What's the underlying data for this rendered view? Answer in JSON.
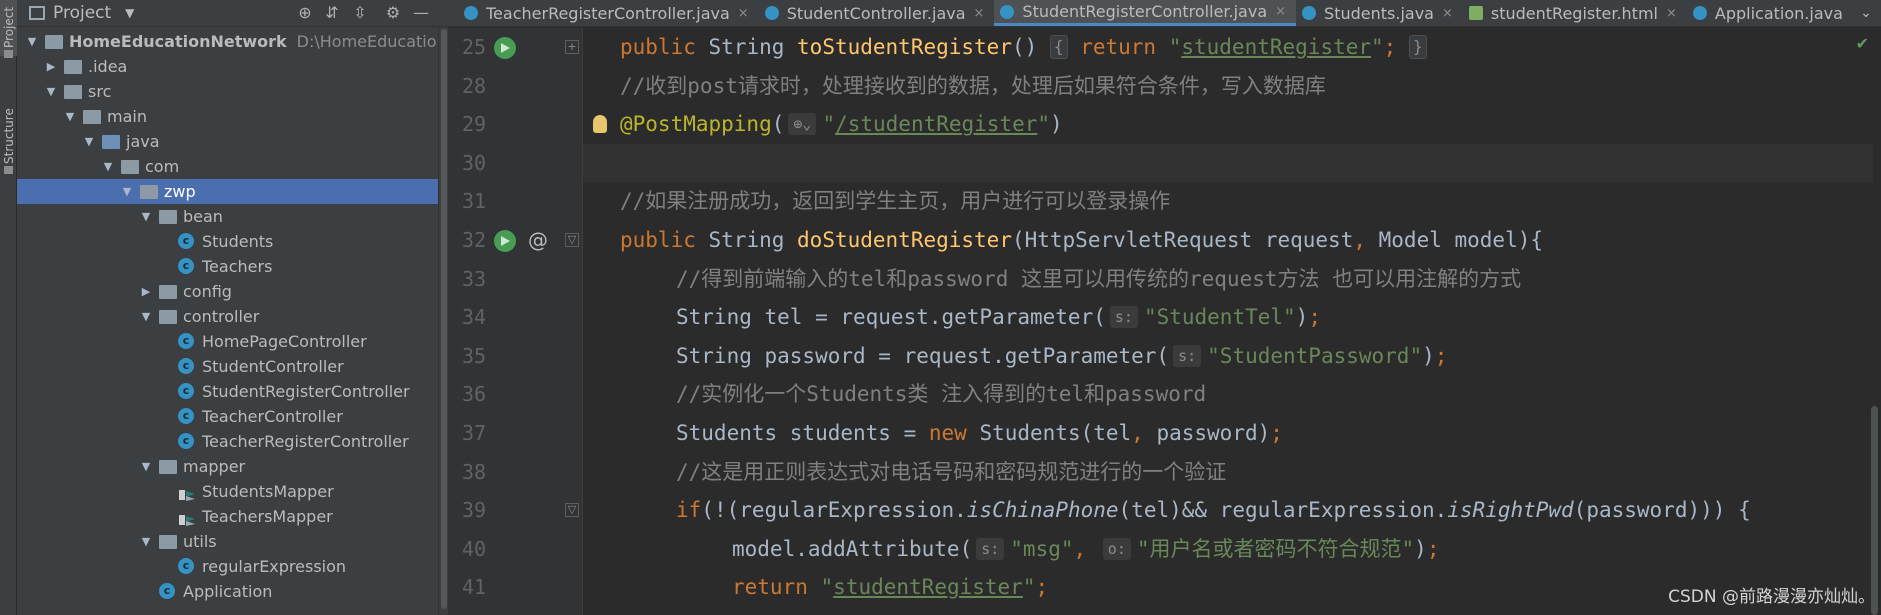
{
  "toolstrip": {
    "project_label": "Project",
    "structure_label": "Structure"
  },
  "project_panel": {
    "title": "Project",
    "icons": [
      "globe-icon",
      "collapse-all-icon",
      "expand-all-icon",
      "gear-icon",
      "minimize-icon"
    ],
    "tree": [
      {
        "name": "HomeEducationNetwork",
        "path": "D:\\HomeEducationNetwork",
        "kind": "module",
        "depth": 0,
        "expanded": true
      },
      {
        "name": ".idea",
        "kind": "folder",
        "depth": 1,
        "expanded": false
      },
      {
        "name": "src",
        "kind": "folder",
        "depth": 1,
        "expanded": true
      },
      {
        "name": "main",
        "kind": "folder",
        "depth": 2,
        "expanded": true
      },
      {
        "name": "java",
        "kind": "source-folder",
        "depth": 3,
        "expanded": true
      },
      {
        "name": "com",
        "kind": "package",
        "depth": 4,
        "expanded": true
      },
      {
        "name": "zwp",
        "kind": "package",
        "depth": 5,
        "expanded": true,
        "selected": true
      },
      {
        "name": "bean",
        "kind": "package",
        "depth": 6,
        "expanded": true
      },
      {
        "name": "Students",
        "kind": "class",
        "depth": 7
      },
      {
        "name": "Teachers",
        "kind": "class",
        "depth": 7
      },
      {
        "name": "config",
        "kind": "package",
        "depth": 6,
        "expanded": false
      },
      {
        "name": "controller",
        "kind": "package",
        "depth": 6,
        "expanded": true
      },
      {
        "name": "HomePageController",
        "kind": "class",
        "depth": 7
      },
      {
        "name": "StudentController",
        "kind": "class",
        "depth": 7
      },
      {
        "name": "StudentRegisterController",
        "kind": "class",
        "depth": 7
      },
      {
        "name": "TeacherController",
        "kind": "class",
        "depth": 7
      },
      {
        "name": "TeacherRegisterController",
        "kind": "class",
        "depth": 7
      },
      {
        "name": "mapper",
        "kind": "package",
        "depth": 6,
        "expanded": true
      },
      {
        "name": "StudentsMapper",
        "kind": "mapper",
        "depth": 7
      },
      {
        "name": "TeachersMapper",
        "kind": "mapper",
        "depth": 7
      },
      {
        "name": "utils",
        "kind": "package",
        "depth": 6,
        "expanded": true
      },
      {
        "name": "regularExpression",
        "kind": "class",
        "depth": 7
      },
      {
        "name": "Application",
        "kind": "app-class",
        "depth": 6
      }
    ]
  },
  "tabs": [
    {
      "label": "TeacherRegisterController.java",
      "icon": "class-icon",
      "active": false,
      "closable": true
    },
    {
      "label": "StudentController.java",
      "icon": "class-icon",
      "active": false,
      "closable": true
    },
    {
      "label": "StudentRegisterController.java",
      "icon": "class-icon",
      "active": true,
      "closable": true
    },
    {
      "label": "Students.java",
      "icon": "class-icon",
      "active": false,
      "closable": true
    },
    {
      "label": "studentRegister.html",
      "icon": "html-icon",
      "active": false,
      "closable": true
    },
    {
      "label": "Application.java",
      "icon": "class-icon",
      "active": false,
      "closable": false
    }
  ],
  "editor": {
    "lines": [
      {
        "num": "25",
        "markers": [
          "run"
        ],
        "fold": "+",
        "segs": [
          {
            "t": "public ",
            "c": "kw"
          },
          {
            "t": "String "
          },
          {
            "t": "toStudentRegister",
            "c": "fn"
          },
          {
            "t": "() "
          },
          {
            "t": "{",
            "c": "fold"
          },
          {
            "t": " return ",
            "c": "kw"
          },
          {
            "t": "\"",
            "c": "str"
          },
          {
            "t": "studentRegister",
            "c": "str u"
          },
          {
            "t": "\"",
            "c": "str"
          },
          {
            "t": ";",
            "c": "kw"
          },
          {
            "t": " "
          },
          {
            "t": "}",
            "c": "fold"
          }
        ]
      },
      {
        "num": "28",
        "segs": [
          {
            "t": "//收到post请求时，处理接收到的数据，处理后如果符合条件，写入数据库",
            "c": "cm"
          }
        ]
      },
      {
        "num": "29",
        "markers": [
          "bulb"
        ],
        "segs": [
          {
            "t": "@PostMapping",
            "c": "ann"
          },
          {
            "t": "("
          },
          {
            "t": "⊕⌄",
            "c": "hint"
          },
          {
            "t": "\"",
            "c": "str"
          },
          {
            "t": "/studentRegister",
            "c": "str u"
          },
          {
            "t": "\"",
            "c": "str"
          },
          {
            "t": ")"
          }
        ]
      },
      {
        "num": "30",
        "caret": true,
        "segs": []
      },
      {
        "num": "31",
        "segs": [
          {
            "t": "//如果注册成功，返回到学生主页，用户进行可以登录操作",
            "c": "cm"
          }
        ]
      },
      {
        "num": "32",
        "markers": [
          "run",
          "at"
        ],
        "fold": "▽",
        "segs": [
          {
            "t": "public ",
            "c": "kw"
          },
          {
            "t": "String "
          },
          {
            "t": "doStudentRegister",
            "c": "fn"
          },
          {
            "t": "(HttpServletRequest request"
          },
          {
            "t": ", ",
            "c": "kw"
          },
          {
            "t": "Model model){"
          }
        ]
      },
      {
        "num": "33",
        "indent": 1,
        "segs": [
          {
            "t": "//得到前端输入的tel和password 这里可以用传统的request方法 也可以用注解的方式",
            "c": "cm"
          }
        ]
      },
      {
        "num": "34",
        "indent": 1,
        "segs": [
          {
            "t": "String tel = request.getParameter("
          },
          {
            "t": "s:",
            "c": "hint"
          },
          {
            "t": "\"StudentTel\"",
            "c": "str"
          },
          {
            "t": ")"
          },
          {
            "t": ";",
            "c": "kw"
          }
        ]
      },
      {
        "num": "35",
        "indent": 1,
        "segs": [
          {
            "t": "String password = request.getParameter("
          },
          {
            "t": "s:",
            "c": "hint"
          },
          {
            "t": "\"StudentPassword\"",
            "c": "str"
          },
          {
            "t": ")"
          },
          {
            "t": ";",
            "c": "kw"
          }
        ]
      },
      {
        "num": "36",
        "indent": 1,
        "segs": [
          {
            "t": "//实例化一个Students类 注入得到的tel和password",
            "c": "cm"
          }
        ]
      },
      {
        "num": "37",
        "indent": 1,
        "segs": [
          {
            "t": "Students students = "
          },
          {
            "t": "new ",
            "c": "kw"
          },
          {
            "t": "Students(tel"
          },
          {
            "t": ", ",
            "c": "kw"
          },
          {
            "t": "password)"
          },
          {
            "t": ";",
            "c": "kw"
          }
        ]
      },
      {
        "num": "38",
        "indent": 1,
        "segs": [
          {
            "t": "//这是用正则表达式对电话号码和密码规范进行的一个验证",
            "c": "cm"
          }
        ]
      },
      {
        "num": "39",
        "indent": 1,
        "fold": "▽",
        "segs": [
          {
            "t": "if",
            "c": "kw"
          },
          {
            "t": "(!(regularExpression."
          },
          {
            "t": "isChinaPhone",
            "c": "it"
          },
          {
            "t": "(tel)&& regularExpression."
          },
          {
            "t": "isRightPwd",
            "c": "it"
          },
          {
            "t": "(password))) {"
          }
        ]
      },
      {
        "num": "40",
        "indent": 2,
        "segs": [
          {
            "t": "model.addAttribute("
          },
          {
            "t": "s:",
            "c": "hint"
          },
          {
            "t": "\"msg\"",
            "c": "str"
          },
          {
            "t": ", ",
            "c": "kw"
          },
          {
            "t": "o:",
            "c": "hint"
          },
          {
            "t": "\"用户名或者密码不符合规范\"",
            "c": "str"
          },
          {
            "t": ")"
          },
          {
            "t": ";",
            "c": "kw"
          }
        ]
      },
      {
        "num": "41",
        "indent": 2,
        "segs": [
          {
            "t": "return ",
            "c": "kw"
          },
          {
            "t": "\"",
            "c": "str"
          },
          {
            "t": "studentRegister",
            "c": "str u"
          },
          {
            "t": "\"",
            "c": "str"
          },
          {
            "t": ";",
            "c": "kw"
          }
        ]
      }
    ]
  },
  "watermark": "CSDN @前路漫漫亦灿灿。",
  "colors": {
    "keyword": "#cc7832",
    "function": "#ffc66d",
    "string": "#6a8759",
    "comment": "#808080",
    "annotation": "#bbb529",
    "selection": "#4b6eaf"
  }
}
